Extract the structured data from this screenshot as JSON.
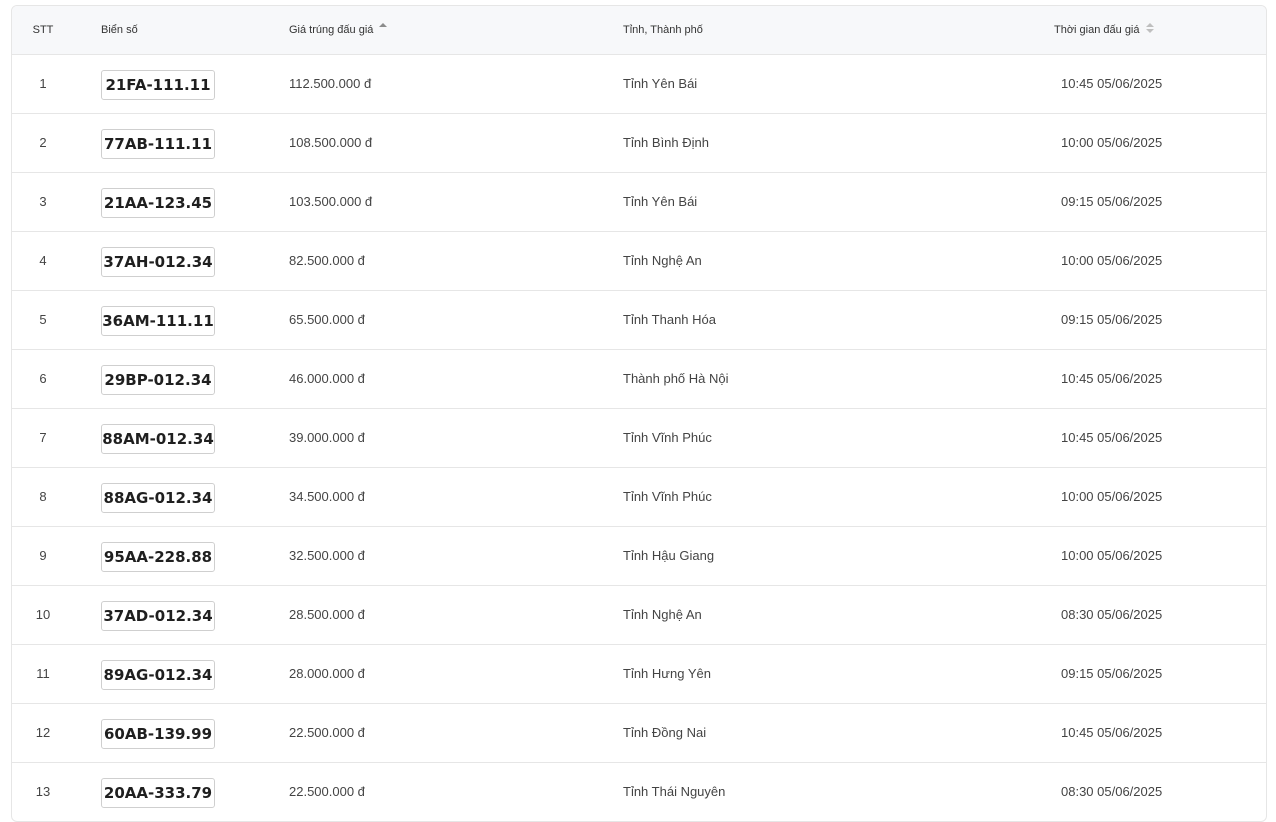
{
  "table": {
    "headers": {
      "stt": "STT",
      "plate": "Biển số",
      "price": "Giá trúng đấu giá",
      "province": "Tỉnh, Thành phố",
      "time": "Thời gian đấu giá"
    },
    "sort": {
      "price": "ascending",
      "time": "none"
    },
    "rows": [
      {
        "stt": "1",
        "plate": "21FA-111.11",
        "price": "112.500.000 đ",
        "province": "Tỉnh Yên Bái",
        "time": "10:45 05/06/2025"
      },
      {
        "stt": "2",
        "plate": "77AB-111.11",
        "price": "108.500.000 đ",
        "province": "Tỉnh Bình Định",
        "time": "10:00 05/06/2025"
      },
      {
        "stt": "3",
        "plate": "21AA-123.45",
        "price": "103.500.000 đ",
        "province": "Tỉnh Yên Bái",
        "time": "09:15 05/06/2025"
      },
      {
        "stt": "4",
        "plate": "37AH-012.34",
        "price": "82.500.000 đ",
        "province": "Tỉnh Nghệ An",
        "time": "10:00 05/06/2025"
      },
      {
        "stt": "5",
        "plate": "36AM-111.11",
        "price": "65.500.000 đ",
        "province": "Tỉnh Thanh Hóa",
        "time": "09:15 05/06/2025"
      },
      {
        "stt": "6",
        "plate": "29BP-012.34",
        "price": "46.000.000 đ",
        "province": "Thành phố Hà Nội",
        "time": "10:45 05/06/2025"
      },
      {
        "stt": "7",
        "plate": "88AM-012.34",
        "price": "39.000.000 đ",
        "province": "Tỉnh Vĩnh Phúc",
        "time": "10:45 05/06/2025"
      },
      {
        "stt": "8",
        "plate": "88AG-012.34",
        "price": "34.500.000 đ",
        "province": "Tỉnh Vĩnh Phúc",
        "time": "10:00 05/06/2025"
      },
      {
        "stt": "9",
        "plate": "95AA-228.88",
        "price": "32.500.000 đ",
        "province": "Tỉnh Hậu Giang",
        "time": "10:00 05/06/2025"
      },
      {
        "stt": "10",
        "plate": "37AD-012.34",
        "price": "28.500.000 đ",
        "province": "Tỉnh Nghệ An",
        "time": "08:30 05/06/2025"
      },
      {
        "stt": "11",
        "plate": "89AG-012.34",
        "price": "28.000.000 đ",
        "province": "Tỉnh Hưng Yên",
        "time": "09:15 05/06/2025"
      },
      {
        "stt": "12",
        "plate": "60AB-139.99",
        "price": "22.500.000 đ",
        "province": "Tỉnh Đồng Nai",
        "time": "10:45 05/06/2025"
      },
      {
        "stt": "13",
        "plate": "20AA-333.79",
        "price": "22.500.000 đ",
        "province": "Tỉnh Thái Nguyên",
        "time": "08:30 05/06/2025"
      }
    ]
  },
  "icons": {
    "price_sort": "sort-ascending-icon",
    "time_sort": "sort-icon"
  },
  "colors": {
    "header_bg": "#f7f8fa",
    "border": "#e6e6e6",
    "text": "#444444"
  }
}
